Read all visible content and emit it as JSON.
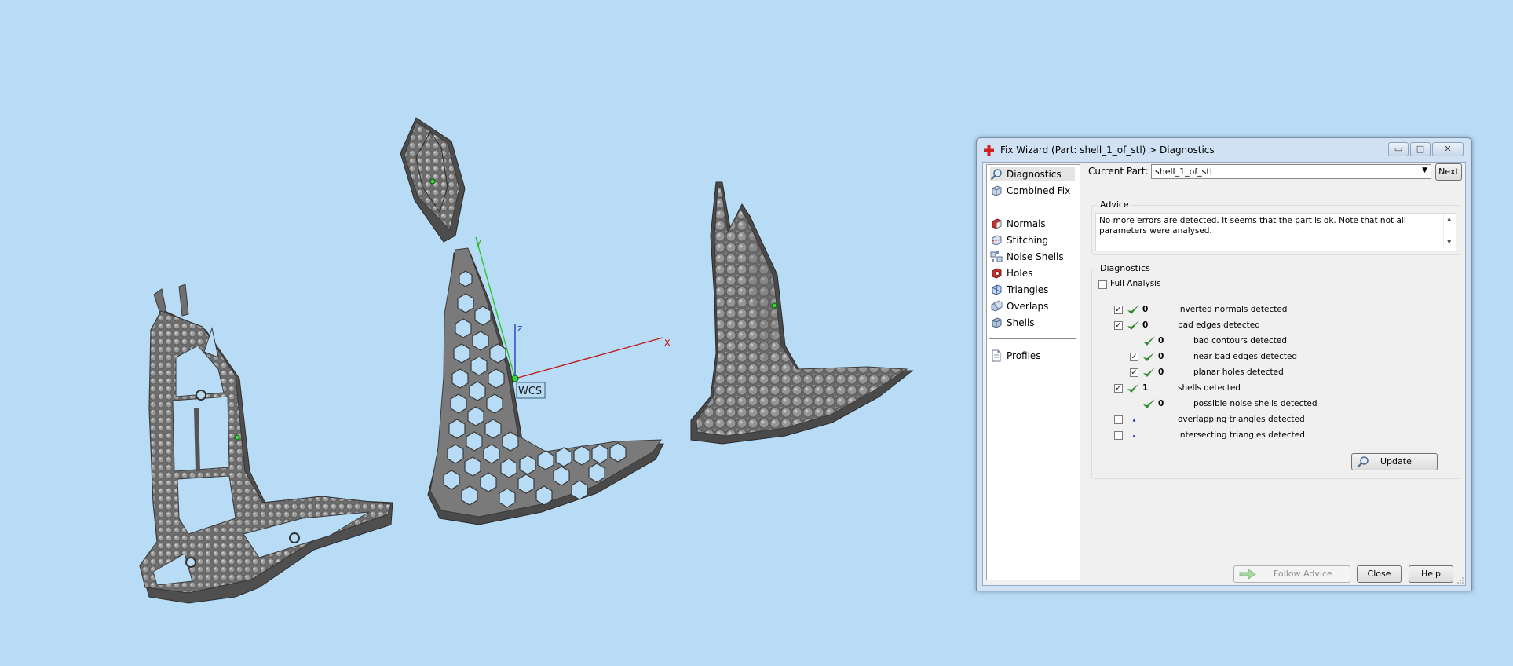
{
  "viewport": {
    "axis_labels": {
      "x": "x",
      "y": "y",
      "z": "z"
    },
    "wcs_label": "WCS"
  },
  "dialog": {
    "title": "Fix Wizard (Part: shell_1_of_stl) > Diagnostics",
    "window_buttons": {
      "minimize": "▭",
      "maximize": "□",
      "close": "✕"
    },
    "nav": {
      "top_items": [
        {
          "label": "Diagnostics",
          "icon": "magnifier-icon",
          "selected": true
        },
        {
          "label": "Combined Fix",
          "icon": "cube-icon",
          "selected": false
        }
      ],
      "fix_items": [
        {
          "label": "Normals",
          "icon": "normals-icon"
        },
        {
          "label": "Stitching",
          "icon": "stitching-icon"
        },
        {
          "label": "Noise Shells",
          "icon": "noise-shells-icon"
        },
        {
          "label": "Holes",
          "icon": "holes-icon"
        },
        {
          "label": "Triangles",
          "icon": "triangles-icon"
        },
        {
          "label": "Overlaps",
          "icon": "overlaps-icon"
        },
        {
          "label": "Shells",
          "icon": "shells-icon"
        }
      ],
      "profiles": {
        "label": "Profiles",
        "icon": "document-icon"
      }
    },
    "current_part": {
      "label": "Current Part:",
      "value": "shell_1_of_stl"
    },
    "next_label": "Next",
    "advice": {
      "title": "Advice",
      "text": "No more errors are detected. It seems that the part is ok. Note that not all parameters were analysed."
    },
    "diagnostics": {
      "title": "Diagnostics",
      "full_analysis": {
        "label": "Full Analysis",
        "checked": false
      },
      "rows": [
        {
          "checked": true,
          "has_checkbox": true,
          "status": "ok",
          "count": "0",
          "label": "inverted normals detected",
          "indent": 0
        },
        {
          "checked": true,
          "has_checkbox": true,
          "status": "ok",
          "count": "0",
          "label": "bad edges detected",
          "indent": 0
        },
        {
          "checked": false,
          "has_checkbox": false,
          "status": "ok",
          "count": "0",
          "label": "bad contours detected",
          "indent": 1
        },
        {
          "checked": true,
          "has_checkbox": true,
          "status": "ok",
          "count": "0",
          "label": "near bad edges detected",
          "indent": 1
        },
        {
          "checked": true,
          "has_checkbox": true,
          "status": "ok",
          "count": "0",
          "label": "planar holes detected",
          "indent": 1
        },
        {
          "checked": true,
          "has_checkbox": true,
          "status": "ok",
          "count": "1",
          "label": "shells detected",
          "indent": 0
        },
        {
          "checked": false,
          "has_checkbox": false,
          "status": "ok",
          "count": "0",
          "label": "possible noise shells detected",
          "indent": 1
        },
        {
          "checked": false,
          "has_checkbox": true,
          "status": "unknown",
          "count": "",
          "label": "overlapping triangles detected",
          "indent": 0
        },
        {
          "checked": false,
          "has_checkbox": true,
          "status": "unknown",
          "count": "",
          "label": "intersecting triangles detected",
          "indent": 0
        }
      ],
      "update_label": "Update"
    },
    "buttons": {
      "follow_advice": "Follow Advice",
      "close": "Close",
      "help": "Help"
    },
    "colors": {
      "accent_check": "#2e8b2e",
      "dot": "#2a3da8",
      "background": "#b8dcf5"
    }
  }
}
